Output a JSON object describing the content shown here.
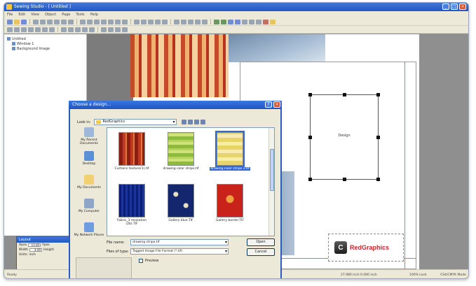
{
  "app": {
    "title": "Sewing Studio - [ Untitled ]",
    "menu": [
      "File",
      "Edit",
      "View",
      "Object",
      "Page",
      "Tools",
      "Help"
    ]
  },
  "tree": {
    "items": [
      {
        "label": "Untitled",
        "level": 0
      },
      {
        "label": "Window 1",
        "level": 1
      },
      {
        "label": "Background Image",
        "level": 1
      }
    ]
  },
  "canvas": {
    "design_label": "Design",
    "logo_text": "RedGraphics",
    "logo_glyph": "C"
  },
  "palette": {
    "title": "Layout",
    "rows": [
      {
        "label": "Xpos",
        "value": "13.00",
        "label2": "Ypos"
      },
      {
        "label": "Width",
        "value": "4.00",
        "label2": "Height"
      },
      {
        "label": "Units: inch",
        "value": "",
        "label2": ""
      }
    ]
  },
  "dialog": {
    "title": "Choose a design...",
    "look_in_label": "Look in:",
    "look_in_value": "RedGraphics",
    "places": [
      "My Recent Documents",
      "Desktop",
      "My Documents",
      "My Computer",
      "My Network Places"
    ],
    "files": [
      {
        "name": "Curtains texture(1).tif",
        "selected": false
      },
      {
        "name": "drawing color stripe.tif",
        "selected": false
      },
      {
        "name": "drawing color stripe 2.tif",
        "selected": true
      },
      {
        "name": "Fabric_3 resolution (2b).TIF",
        "selected": false
      },
      {
        "name": "Gallery blue.TIF",
        "selected": false
      },
      {
        "name": "Gallery border.TIF",
        "selected": false
      }
    ],
    "file_name_label": "File name:",
    "file_name_value": "drawing stripe.tif",
    "files_of_type_label": "Files of type:",
    "files_of_type_value": "Tagged Image File Format (*.tif)",
    "open_label": "Open",
    "cancel_label": "Cancel",
    "preview_label": "Preview"
  },
  "status": {
    "left": "Ready",
    "coords": "27.980 inch  0.000 inch",
    "zoom": "100% Lock",
    "doc": "CS4/CMYK Mode"
  }
}
